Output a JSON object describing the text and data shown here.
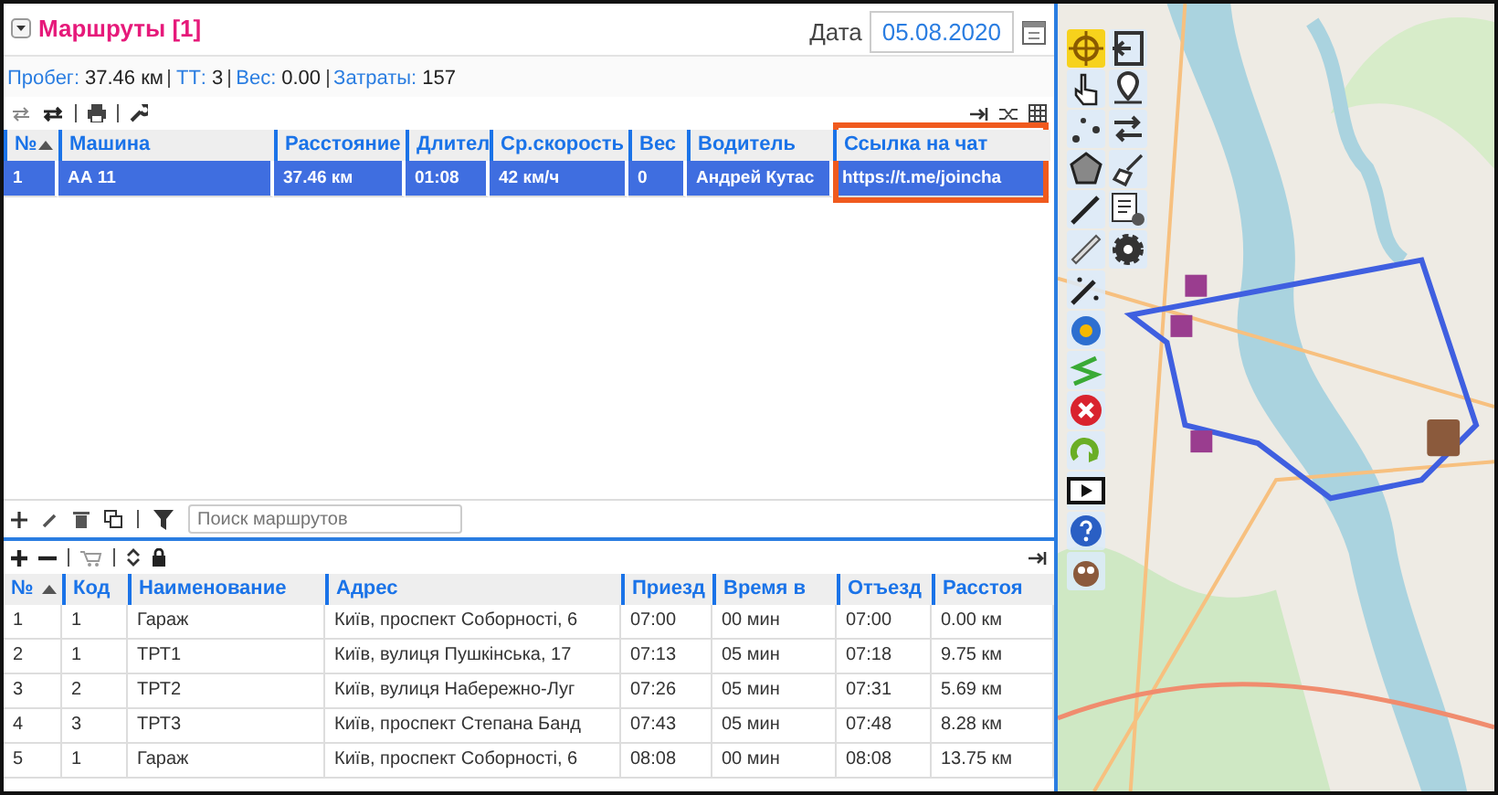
{
  "header": {
    "title": "Маршруты [1]",
    "date_label": "Дата",
    "date": "05.08.2020"
  },
  "summary": [
    {
      "label": "Пробег:",
      "value": "37.46 км"
    },
    {
      "label": "ТТ:",
      "value": "3"
    },
    {
      "label": "Вес:",
      "value": "0.00"
    },
    {
      "label": "Затраты:",
      "value": "157"
    }
  ],
  "routes": {
    "columns": [
      {
        "label": "№",
        "sorted": true,
        "highlighted": false
      },
      {
        "label": "Машина",
        "sorted": false,
        "highlighted": false
      },
      {
        "label": "Расстояние",
        "sorted": false,
        "highlighted": false
      },
      {
        "label": "Длител",
        "sorted": false,
        "highlighted": false
      },
      {
        "label": "Ср.скорость",
        "sorted": false,
        "highlighted": false
      },
      {
        "label": "Вес",
        "sorted": false,
        "highlighted": false
      },
      {
        "label": "Водитель",
        "sorted": false,
        "highlighted": false
      },
      {
        "label": "Ссылка на чат",
        "sorted": false,
        "highlighted": true
      }
    ],
    "rows": [
      {
        "selected": true,
        "cells": [
          "1",
          "АА 11",
          "37.46 км",
          "01:08",
          "42 км/ч",
          "0",
          "Андрей Кутас",
          "https://t.me/joincha"
        ]
      }
    ]
  },
  "route_search": {
    "placeholder": "Поиск маршрутов"
  },
  "stops": {
    "columns": [
      {
        "label": "№",
        "sorted": true
      },
      {
        "label": "Код",
        "sorted": false
      },
      {
        "label": "Наименование",
        "sorted": false
      },
      {
        "label": "Адрес",
        "sorted": false
      },
      {
        "label": "Приезд",
        "sorted": false
      },
      {
        "label": "Время в",
        "sorted": false
      },
      {
        "label": "Отъезд",
        "sorted": false
      },
      {
        "label": "Расстоя",
        "sorted": false
      }
    ],
    "rows": [
      {
        "selected": false,
        "cells": [
          "1",
          "1",
          "Гараж",
          "Київ, проспект Соборності, 6",
          "07:00",
          "00 мин",
          "07:00",
          "0.00 км"
        ]
      },
      {
        "selected": false,
        "cells": [
          "2",
          "1",
          "ТРТ1",
          "Київ, вулиця Пушкінська, 17",
          "07:13",
          "05 мин",
          "07:18",
          "9.75 км"
        ]
      },
      {
        "selected": false,
        "cells": [
          "3",
          "2",
          "ТРТ2",
          "Київ, вулиця Набережно-Луг",
          "07:26",
          "05 мин",
          "07:31",
          "5.69 км"
        ]
      },
      {
        "selected": false,
        "cells": [
          "4",
          "3",
          "ТРТ3",
          "Київ, проспект Степана Банд",
          "07:43",
          "05 мин",
          "07:48",
          "8.28 км"
        ]
      },
      {
        "selected": false,
        "cells": [
          "5",
          "1",
          "Гараж",
          "Київ, проспект Соборності, 6",
          "08:08",
          "00 мин",
          "08:08",
          "13.75 км"
        ]
      }
    ]
  }
}
